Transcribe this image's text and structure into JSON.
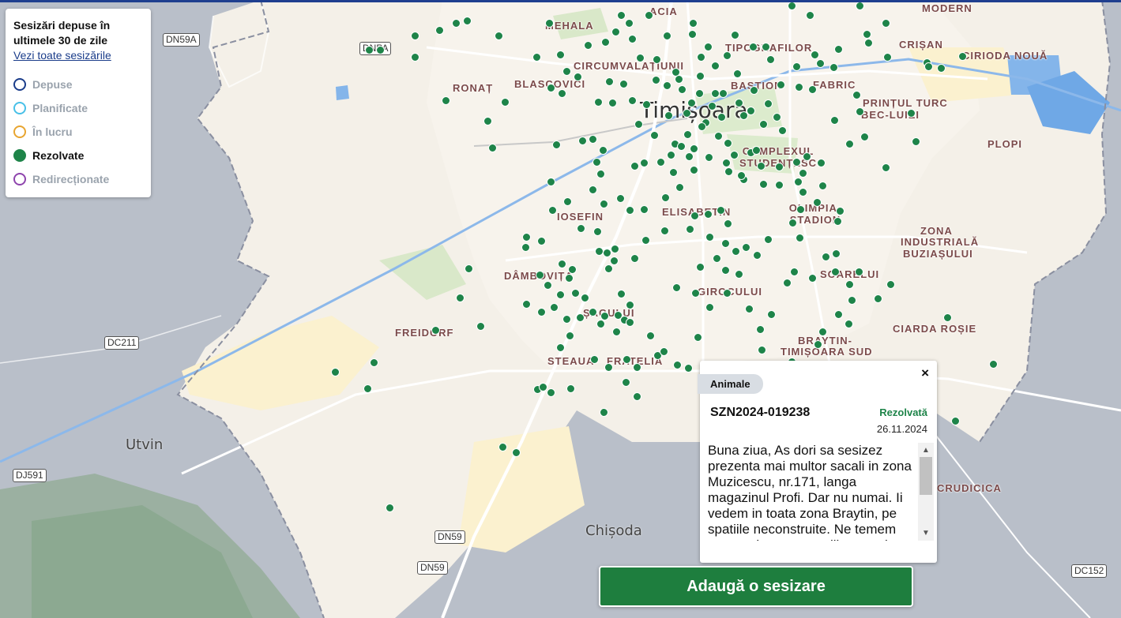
{
  "legend": {
    "title": "Sesizări depuse în ultimele 30 de zile",
    "link": "Vezi toate sesizările",
    "items": [
      {
        "label": "Depuse",
        "color": "#1a3c8a",
        "active": false
      },
      {
        "label": "Planificate",
        "color": "#48c0e8",
        "active": false
      },
      {
        "label": "În lucru",
        "color": "#e8a530",
        "active": false
      },
      {
        "label": "Rezolvate",
        "color": "#1e8449",
        "active": true
      },
      {
        "label": "Redirecționate",
        "color": "#8e44ad",
        "active": false
      }
    ]
  },
  "map": {
    "city": "Timișoara",
    "districts": [
      "MODERN",
      "MEHALA",
      "CIRCUMVALAȚIUNII",
      "TIPOGRAFILOR",
      "CRIȘAN",
      "CIRIODA NOUĂ",
      "RONAȚ",
      "BLASCOVICI",
      "BASTION",
      "FABRIC",
      "PRINȚUL TURC",
      "BEC-LUIEI",
      "PLOPI",
      "COMPLEXUL STUDENȚESC",
      "IOSEFIN",
      "ELISABETIN",
      "OLIMPIA-STADION",
      "ZONA",
      "INDUSTRIALĂ",
      "BUZIAȘULUI",
      "DÂMBOVIȚA",
      "GIROCULUI",
      "SOARELUI",
      "ȘAGULUI",
      "FREIDORF",
      "CIARDA ROȘIE",
      "BRAYTIN-",
      "TIMIȘOARA SUD",
      "STEAUA",
      "FRATELIA",
      "CRUDICICA",
      "ACIA"
    ],
    "towns": [
      "Utvin",
      "Chișoda"
    ],
    "roads": [
      "DN59A",
      "DJ591",
      "DC211",
      "DN59",
      "DN59",
      "DC152",
      "DNPA"
    ],
    "dot_color": "#1e8449"
  },
  "popup": {
    "category": "Animale",
    "id": "SZN2024-019238",
    "status": "Rezolvată",
    "date": "26.11.2024",
    "text": "Buna ziua, As dori sa sesizez prezenta mai multor sacali in zona Muzicescu, nr.171, langa magazinul Profi. Dar nu numai. Ii vedem in toata zona Braytin, pe spatiile neconstruite. Ne temem pentru siguranta copiilor nostri.",
    "close": "×"
  },
  "add_button": "Adaugă o sesizare"
}
